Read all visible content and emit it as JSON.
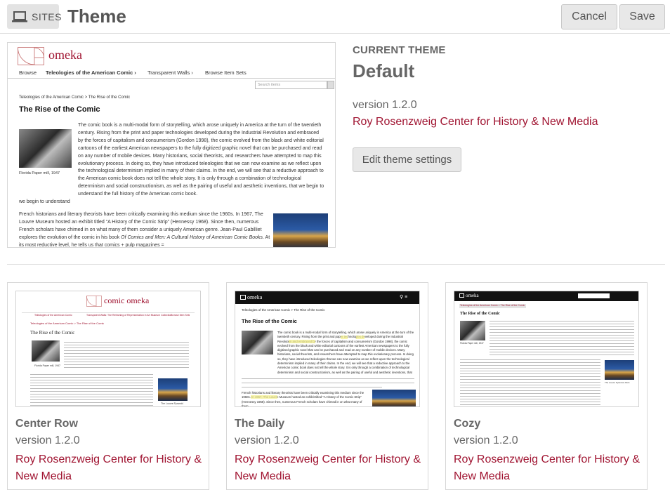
{
  "header": {
    "sites_label": "SITES",
    "title": "Theme",
    "cancel_label": "Cancel",
    "save_label": "Save"
  },
  "current": {
    "label": "CURRENT THEME",
    "name": "Default",
    "version": "version 1.2.0",
    "author": "Roy Rosenzweig Center for History & New Media",
    "edit_label": "Edit theme settings",
    "preview": {
      "logo": "omeka",
      "nav": [
        "Browse",
        "Teleologies of the American Comic",
        "Transparent Walls",
        "Browse Item Sets"
      ],
      "search_placeholder": "Search items",
      "breadcrumb": "Teleologies of the American Comic > The Rise of the Comic",
      "heading": "The Rise of the Comic",
      "caption": "Florida Paper mill, 1947",
      "paragraph1": "The comic book is a multi-modal form of storytelling, which arose uniquely in America at the turn of the twentieth century. Rising from the print and paper technologies developed during the Industrial Revolution and embraced by the forces of capitalism and consumerism (Gordon 1998), the comic evolved from the black and white editorial cartoons of the earliest American newspapers to the fully digitized graphic novel that can be purchased and read on any number of mobile devices. Many historians, social theorists, and researchers have attempted to map this evolutionary process. In doing so, they have introduced teleologies that we can now examine as we reflect upon the technological determinism implied in many of their claims. In the end, we will see that a reductive approach to the American comic book does not tell the whole story. It is only through a combination of technological determinism and social constructionism, as well as the pairing of useful and aesthetic inventions, that we begin to understand the full history of the American comic book.",
      "paragraph2_a": "French historians and literary theorists have been critically examining this medium since the 1960s. In 1967, The Louvre Museum hosted an exhibit titled “A History of the Comic Strip” (Hennessy 1968). Since then, numerous French scholars have chimed in on what many of them consider a uniquely American genre. Jean-Paul Gabilliet explores the evolution of the comic in his book ",
      "paragraph2_b": "Of Comics and Men: A Cultural History of American Comic Books",
      "paragraph2_c": ". At its most reductive level, he tells us that comics + pulp magazines ="
    }
  },
  "themes": [
    {
      "name": "Center Row",
      "version": "version 1.2.0",
      "author": "Roy Rosenzweig Center for History & New Media",
      "preview": {
        "logo": "comic omeka",
        "nav": [
          "Teleologies of the American Comic",
          "Transparent Walls: The Reframing of Representation in Art Museum Collections",
          "Browse Item Sets"
        ],
        "breadcrumb": "Teleologies of the American Comic > The Rise of the Comic",
        "heading": "The Rise of the Comic",
        "caption": "Florida Paper mill, 1947",
        "caption2": "The Louvre Pyramid"
      }
    },
    {
      "name": "The Daily",
      "version": "version 1.2.0",
      "author": "Roy Rosenzweig Center for History & New Media",
      "preview": {
        "logo": "omeka",
        "breadcrumb": "Teleologies of the American Comic > The Rise of the Comic",
        "heading": "The Rise of the Comic",
        "paragraph1": "The comic book is a multi-modal form of storytelling, which arose uniquely in America at the turn of the twentieth century. Rising from the print and paper technologies developed during the Industrial Revolution and embraced by the forces of capitalism and consumerism (Gordon 1998), the comic evolved from the black and white editorial cartoons of the earliest American newspapers to the fully digitized graphic novel that can be purchased and read on any number of mobile devices. Many historians, social theorists, and researchers have attempted to map this evolutionary process. In doing so, they have introduced teleologies that we can now examine as we reflect upon the technological determinism implied in many of their claims. In the end, we will see that a reductive approach to the American comic book does not tell the whole story. It is only through a combination of technological determinism and social constructionism, as well as the pairing of useful and aesthetic inventions, that we begin to understand the full history of the American comic book.",
        "paragraph2": "French historians and literary theorists have been critically examining this medium since the 1960s. In 1967, The Louvre Museum hosted an exhibit titled “A History of the Comic Strip” (Hennessy 1968). Since then, numerous French scholars have chimed in on what many of them"
      }
    },
    {
      "name": "Cozy",
      "version": "version 1.2.0",
      "author": "Roy Rosenzweig Center for History & New Media",
      "preview": {
        "logo": "omeka",
        "breadcrumb": "Teleologies of the American Comic > The Rise of the Comic",
        "heading": "The Rise of the Comic",
        "caption": "Florida Paper mill, 1947",
        "caption2": "The Louvre Pyramid, Paris"
      }
    }
  ],
  "colors": {
    "accent": "#a01431",
    "highlight": "#f3f08a",
    "dark_bar": "#111111"
  },
  "icons": {
    "sites": "laptop-icon",
    "search": "search-icon",
    "logo": "golden-spiral-logo"
  }
}
